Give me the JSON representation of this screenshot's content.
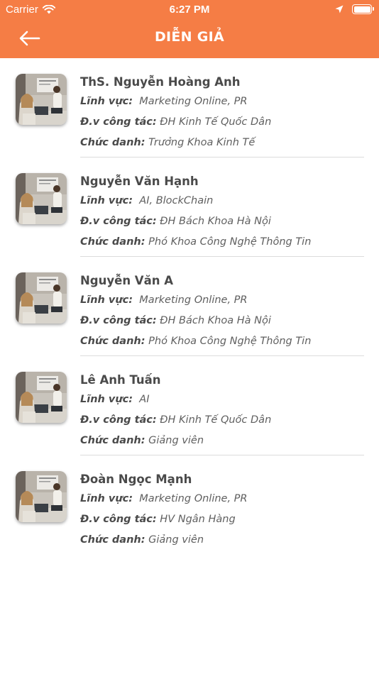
{
  "status_bar": {
    "carrier": "Carrier",
    "time": "6:27 PM"
  },
  "nav": {
    "title": "DIỄN GIẢ",
    "back_icon": "arrow-left-icon"
  },
  "labels": {
    "field": "Lĩnh vực:",
    "org": "Đ.v công tác:",
    "title": "Chức danh:"
  },
  "colors": {
    "header": "#f57d45",
    "text": "#4a4a4a",
    "divider": "#dcdcdc"
  },
  "speakers": [
    {
      "name": "ThS. Nguyễn Hoàng Anh",
      "field": "Marketing Online, PR",
      "org": "ĐH Kinh Tế Quốc Dân",
      "title": "Trưởng Khoa Kinh Tế"
    },
    {
      "name": "Nguyễn Văn Hạnh",
      "field": "AI, BlockChain",
      "org": "ĐH Bách Khoa Hà Nội",
      "title": "Phó Khoa Công Nghệ Thông Tin"
    },
    {
      "name": "Nguyễn Văn A",
      "field": "Marketing Online, PR",
      "org": "ĐH Bách Khoa Hà Nội",
      "title": "Phó Khoa Công Nghệ Thông Tin"
    },
    {
      "name": "Lê Anh Tuấn",
      "field": "AI",
      "org": "ĐH Kinh Tế Quốc Dân",
      "title": "Giảng viên"
    },
    {
      "name": "Đoàn Ngọc Mạnh",
      "field": "Marketing Online, PR",
      "org": "HV Ngân Hàng",
      "title": "Giảng viên"
    }
  ]
}
